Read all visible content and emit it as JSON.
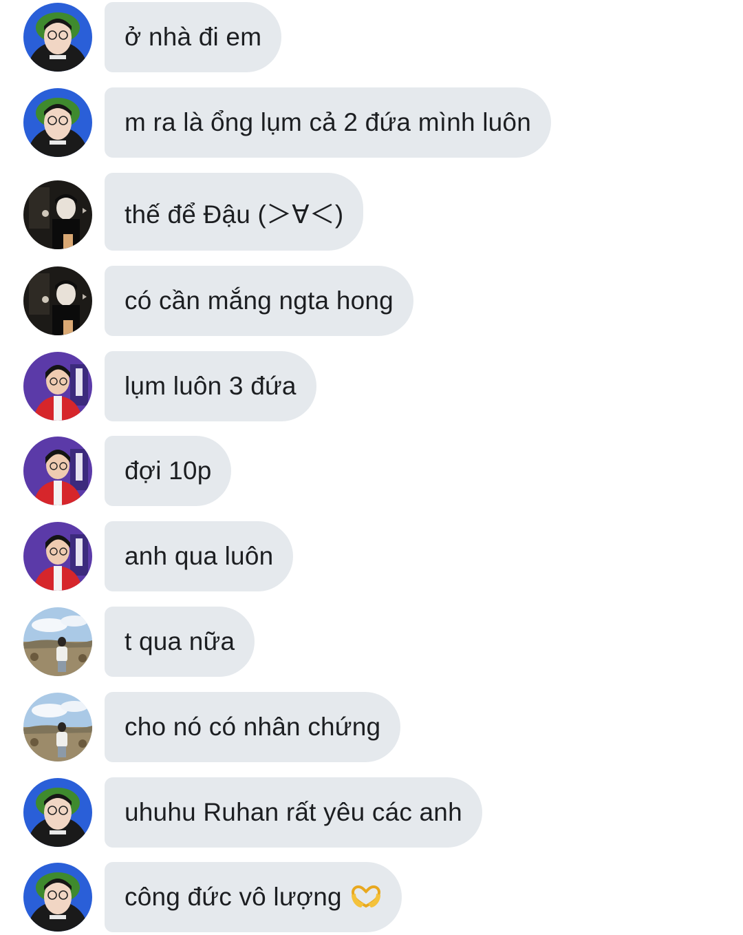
{
  "colors": {
    "bubble": "#e5e9ed",
    "text": "#1c1e21",
    "background": "#ffffff"
  },
  "messages": [
    {
      "avatar": "green-hat-boy-avatar",
      "text": "ở nhà đi em"
    },
    {
      "avatar": "green-hat-boy-avatar",
      "text": "m ra là ổng lụm cả 2 đứa mình luôn"
    },
    {
      "avatar": "dark-photo-avatar",
      "text": "thế để Đậu (＞∀＜)"
    },
    {
      "avatar": "dark-photo-avatar",
      "text": "có cần mắng ngta hong"
    },
    {
      "avatar": "red-jacket-boy-avatar",
      "text": "lụm luôn 3 đứa"
    },
    {
      "avatar": "red-jacket-boy-avatar",
      "text": "đợi 10p"
    },
    {
      "avatar": "red-jacket-boy-avatar",
      "text": "anh qua luôn"
    },
    {
      "avatar": "field-sky-avatar",
      "text": "t qua nữa"
    },
    {
      "avatar": "field-sky-avatar",
      "text": "cho nó có nhân chứng"
    },
    {
      "avatar": "green-hat-boy-avatar",
      "text": "uhuhu Ruhan rất yêu các anh"
    },
    {
      "avatar": "green-hat-boy-avatar",
      "text": "công đức vô lượng",
      "emoji": "heart-hands-icon"
    }
  ]
}
